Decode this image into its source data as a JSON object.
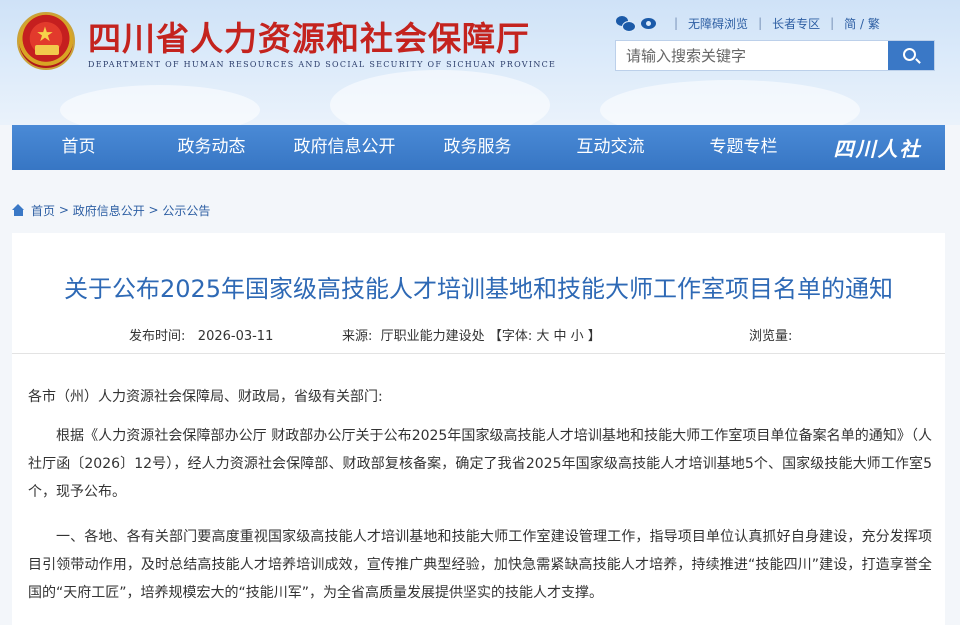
{
  "header": {
    "site_title": "四川省人力资源和社会保障厅",
    "site_subtitle": "DEPARTMENT OF HUMAN RESOURCES AND SOCIAL SECURITY OF SICHUAN PROVINCE",
    "links": {
      "accessible": "无障碍浏览",
      "elderly": "长者专区",
      "lang": "简 / 繁"
    },
    "search": {
      "placeholder": "请输入搜索关键字"
    }
  },
  "nav": {
    "items": [
      "首页",
      "政务动态",
      "政府信息公开",
      "政务服务",
      "互动交流",
      "专题专栏"
    ],
    "brand": "四川人社"
  },
  "breadcrumb": {
    "home": "首页",
    "level2": "政府信息公开",
    "level3": "公示公告"
  },
  "article": {
    "title": "关于公布2025年国家级高技能人才培训基地和技能大师工作室项目名单的通知",
    "meta": {
      "date_label": "发布时间:",
      "date": "2026-03-11",
      "source_label": "来源:",
      "source": "厅职业能力建设处",
      "font_label": "【字体:",
      "font_sizes": "大 中 小",
      "font_end": "】",
      "views_label": "浏览量:"
    },
    "greeting": "各市（州）人力资源社会保障局、财政局，省级有关部门:",
    "para1": "根据《人力资源社会保障部办公厅 财政部办公厅关于公布2025年国家级高技能人才培训基地和技能大师工作室项目单位备案名单的通知》（人社厅函〔2026〕12号），经人力资源社会保障部、财政部复核备案，确定了我省2025年国家级高技能人才培训基地5个、国家级技能大师工作室5个，现予公布。",
    "para2": "一、各地、各有关部门要高度重视国家级高技能人才培训基地和技能大师工作室建设管理工作，指导项目单位认真抓好自身建设，充分发挥项目引领带动作用，及时总结高技能人才培养培训成效，宣传推广典型经验，加快急需紧缺高技能人才培养，持续推进“技能四川”建设，打造享誉全国的“天府工匠”，培养规模宏大的“技能川军”，为全省高质量发展提供坚实的技能人才支撑。"
  }
}
